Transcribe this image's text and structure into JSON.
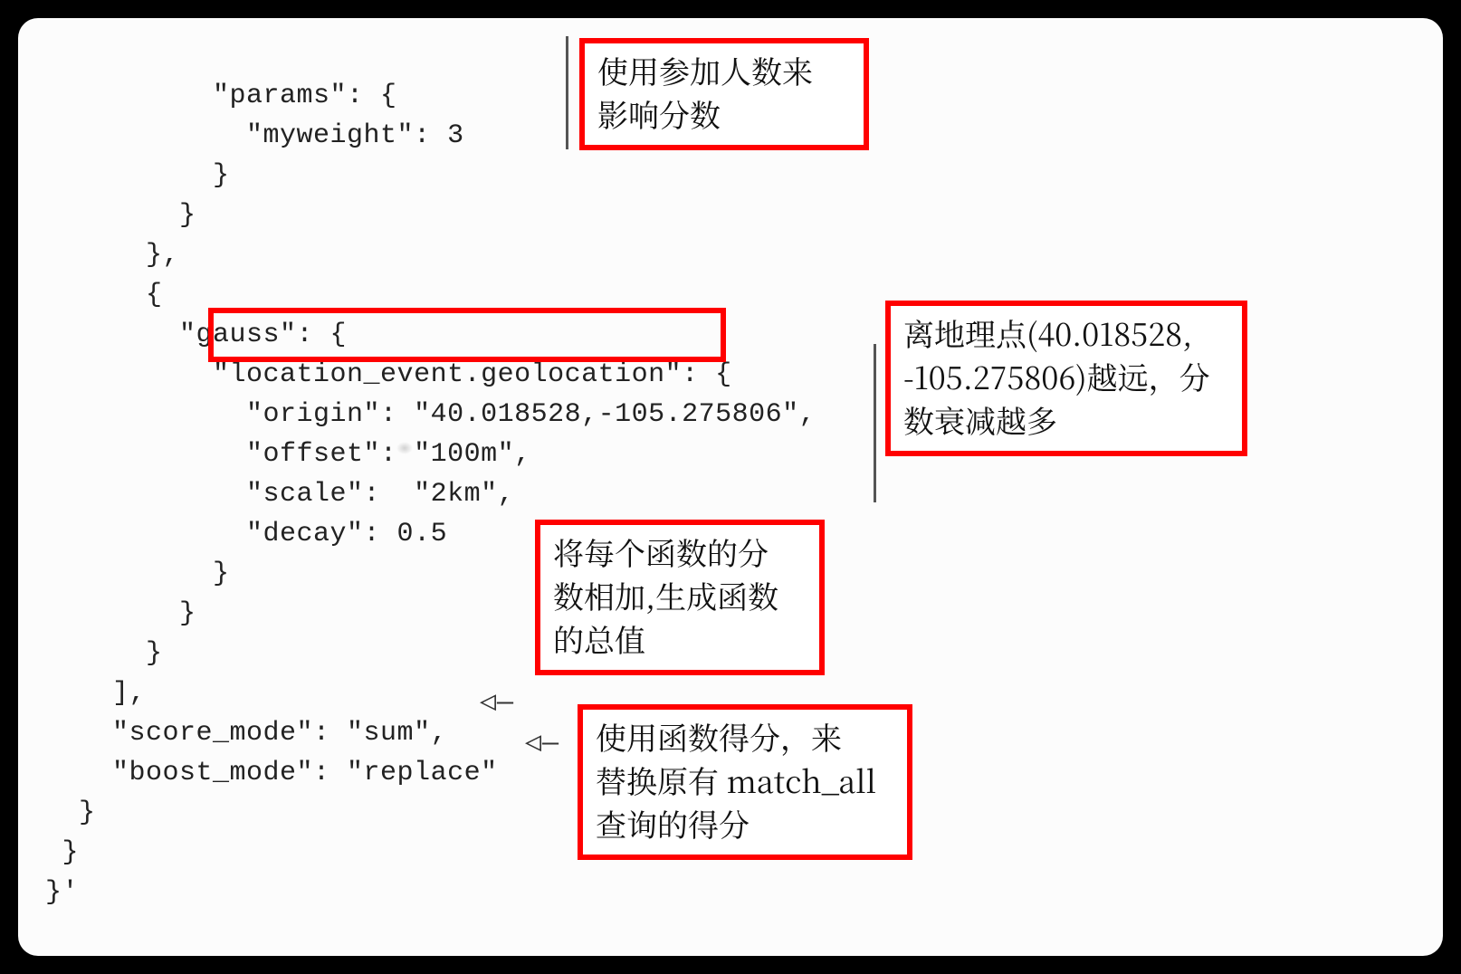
{
  "code": {
    "l1": "          \"params\": {",
    "l2": "            \"myweight\": 3",
    "l3": "          }",
    "l4": "        }",
    "l5": "      },",
    "l6": "      {",
    "l7": "        \"gauss\": {",
    "l8": "          \"location_event.geolocation\": {",
    "l9": "            \"origin\": \"40.018528,-105.275806\",",
    "l10": "            \"offset\": \"100m\",",
    "l11": "            \"scale\":  \"2km\",",
    "l12": "            \"decay\": 0.5",
    "l13": "          }",
    "l14": "        }",
    "l15": "      }",
    "l16": "    ],",
    "l17": "    \"score_mode\": \"sum\",  ",
    "l18": "    \"boost_mode\": \"replace\"  ",
    "l19": "  }",
    "l20": " }",
    "l21": "}'"
  },
  "callouts": {
    "c1": "使用参加人数来\n影响分数",
    "c2": "离地理点(40.018528,\n-105.275806)越远，分\n数衰减越多",
    "c3": "将每个函数的分\n数相加,生成函数\n的总值",
    "c4": "使用函数得分，来\n替换原有 match_all\n查询的得分"
  },
  "arrows": {
    "a3": "◁—",
    "a4": "◁—"
  }
}
